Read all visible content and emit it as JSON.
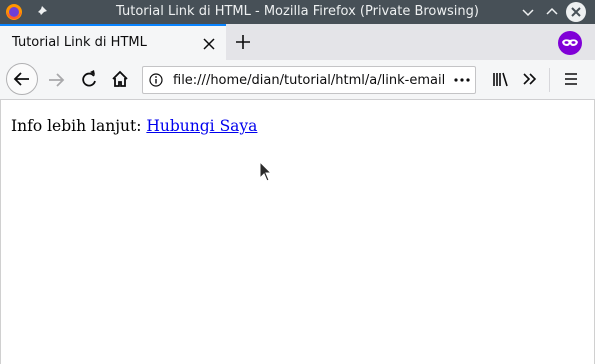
{
  "window": {
    "title": "Tutorial Link di HTML - Mozilla Firefox (Private Browsing)",
    "icons": [
      "firefox-logo",
      "pin-icon",
      "minimize-icon",
      "maximize-icon",
      "close-icon"
    ]
  },
  "tabs": [
    {
      "label": "Tutorial Link di HTML",
      "active": true
    }
  ],
  "navbar": {
    "url": "file:///home/dian/tutorial/html/a/link-email.html",
    "buttons": [
      "back",
      "forward",
      "reload",
      "home",
      "library",
      "overflow",
      "menu"
    ]
  },
  "page": {
    "text": "Info lebih lanjut: ",
    "link_label": "Hubungi Saya"
  },
  "colors": {
    "titlebar": "#475057",
    "tab_accent": "#0a84ff",
    "private_badge": "#8000d7",
    "link": "#0000ee"
  }
}
